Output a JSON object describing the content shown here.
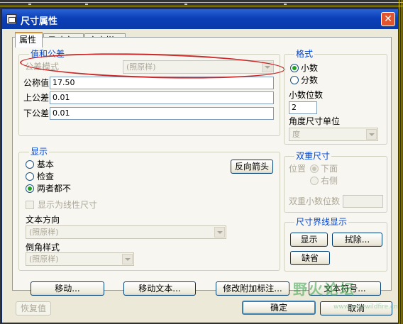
{
  "window": {
    "title": "尺寸属性",
    "close_glyph": "✕"
  },
  "tabs": [
    "属性",
    "尺寸文本",
    "文本样式"
  ],
  "value_tolerance": {
    "group_label": "值和公差",
    "tolerance_mode_label": "公差模式",
    "tolerance_mode_value": "(照原样)",
    "nominal_label": "公称值",
    "nominal_value": "17.50",
    "upper_label": "上公差",
    "upper_value": "0.01",
    "lower_label": "下公差",
    "lower_value": "0.01"
  },
  "format": {
    "group_label": "格式",
    "decimal_label": "小数",
    "fraction_label": "分数",
    "decimal_places_label": "小数位数",
    "decimal_places_value": "2",
    "angle_unit_label": "角度尺寸单位",
    "angle_unit_value": "度"
  },
  "display": {
    "group_label": "显示",
    "basic_label": "基本",
    "inspect_label": "检查",
    "neither_label": "两者都不",
    "flip_arrows_label": "反向箭头",
    "show_linear_label": "显示为线性尺寸",
    "text_orientation_label": "文本方向",
    "text_orientation_value": "(照原样)",
    "chamfer_style_label": "倒角样式",
    "chamfer_style_value": "(照原样)"
  },
  "dual_dim": {
    "group_label": "双重尺寸",
    "position_label": "位置",
    "below_label": "下面",
    "right_label": "右侧",
    "dual_decimal_label": "双重小数位数"
  },
  "witness": {
    "group_label": "尺寸界线显示",
    "show_label": "显示",
    "erase_label": "拭除...",
    "default_label": "缺省"
  },
  "bottom": {
    "move_label": "移动...",
    "move_text_label": "移动文本...",
    "modify_attach_label": "修改附加标注...",
    "text_symbol_label": "文本符号...",
    "restore_label": "恢复值",
    "ok_label": "确定",
    "cancel_label": "取消"
  },
  "watermark": {
    "text": "野火论坛",
    "url": "www.proewildfire.cn"
  },
  "colors": {
    "title_bar": "#0b3fb8",
    "group_label": "#0046d5",
    "annotation": "#cc2a2a",
    "dialog_bg": "#ece9d8"
  }
}
